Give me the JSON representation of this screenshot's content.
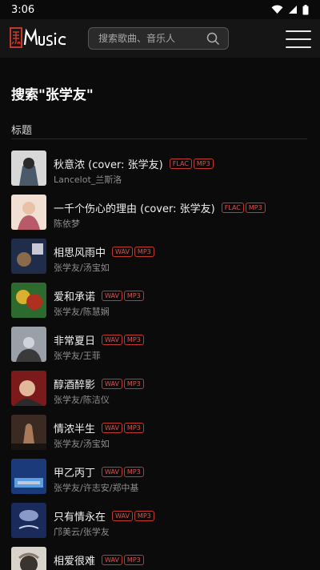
{
  "status_bar": {
    "time": "3:06",
    "icons": [
      "wifi-icon",
      "signal-icon",
      "battery-icon"
    ]
  },
  "header": {
    "logo_alt_text": "黑MUSIC",
    "search_placeholder": "搜索歌曲、音乐人",
    "menu_icon": "hamburger-menu-icon"
  },
  "main": {
    "results_title": "搜索\"张学友\"",
    "section_label": "标题"
  },
  "colors": {
    "background": "#0b0b0b",
    "header": "#151515",
    "badge": "#d9534f",
    "secondary_text": "#8e8e8e"
  },
  "songs": [
    {
      "title": "秋意浓 (cover: 张学友)",
      "artist": "Lancelot_兰斯洛",
      "badges": [
        "FLAC",
        "MP3"
      ],
      "cover_colors": [
        "#d8d8d8",
        "#4a5a6a",
        "#2a2a2a"
      ]
    },
    {
      "title": "一千个伤心的理由 (cover: 张学友)",
      "artist": "陈依梦",
      "badges": [
        "FLAC",
        "MP3"
      ],
      "cover_colors": [
        "#f2dfd4",
        "#b85a6a",
        "#e9c1a6"
      ]
    },
    {
      "title": "相思风雨中",
      "artist": "张学友/汤宝如",
      "badges": [
        "WAV",
        "MP3"
      ],
      "cover_colors": [
        "#1f2c4a",
        "#c9c9d6",
        "#8a6a4a"
      ]
    },
    {
      "title": "爱和承诺",
      "artist": "张学友/陈慧娴",
      "badges": [
        "WAV",
        "MP3"
      ],
      "cover_colors": [
        "#2d6a2d",
        "#d9b030",
        "#b03020"
      ]
    },
    {
      "title": "非常夏日",
      "artist": "张学友/王菲",
      "badges": [
        "WAV",
        "MP3"
      ],
      "cover_colors": [
        "#9aa0a8",
        "#3a3a3a",
        "#d0d4da"
      ]
    },
    {
      "title": "醇酒醉影",
      "artist": "张学友/陈洁仪",
      "badges": [
        "WAV",
        "MP3"
      ],
      "cover_colors": [
        "#7a1a1a",
        "#e2b89a",
        "#2a2a2a"
      ]
    },
    {
      "title": "情浓半生",
      "artist": "张学友/汤宝如",
      "badges": [
        "WAV",
        "MP3"
      ],
      "cover_colors": [
        "#3a2a22",
        "#a87a5a",
        "#1a1410"
      ]
    },
    {
      "title": "甲乙丙丁",
      "artist": "张学友/许志安/郑中基",
      "badges": [
        "WAV",
        "MP3"
      ],
      "cover_colors": [
        "#1a3a7a",
        "#5aa0e0",
        "#c0c8e0"
      ]
    },
    {
      "title": "只有情永在",
      "artist": "邝美云/张学友",
      "badges": [
        "WAV",
        "MP3"
      ],
      "cover_colors": [
        "#1a2a5a",
        "#8a9ac8",
        "#c8d0e8"
      ]
    },
    {
      "title": "相爱很难",
      "artist": "",
      "badges": [
        "WAV",
        "MP3"
      ],
      "cover_colors": [
        "#d8d4cc",
        "#3a3430",
        "#8a7a6a"
      ]
    }
  ]
}
